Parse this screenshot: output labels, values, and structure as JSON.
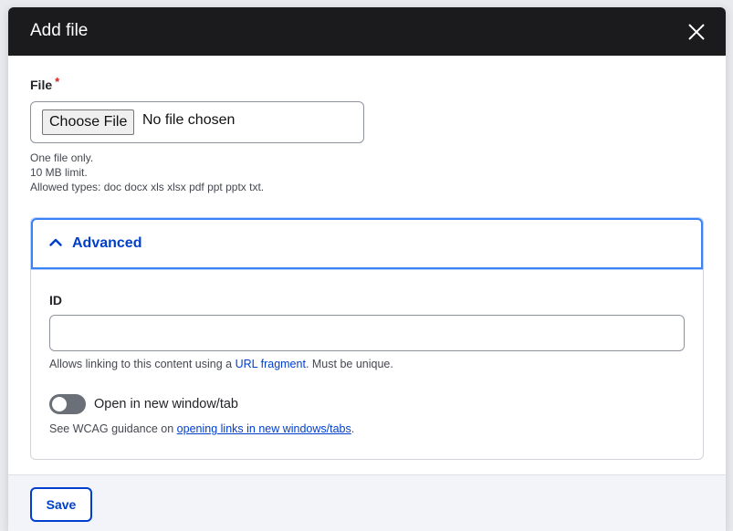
{
  "dialog": {
    "title": "Add file",
    "close_icon": "close-icon"
  },
  "file": {
    "label": "File",
    "required_marker": "*",
    "choose_button": "Choose File",
    "status": "No file chosen",
    "help": [
      "One file only.",
      "10 MB limit.",
      "Allowed types: doc docx xls xlsx pdf ppt pptx txt."
    ]
  },
  "advanced": {
    "title": "Advanced",
    "chevron_icon": "chevron-up-icon",
    "id": {
      "label": "ID",
      "value": "",
      "help_prefix": "Allows linking to this content using a ",
      "help_link": "URL fragment",
      "help_suffix": ". Must be unique."
    },
    "new_window": {
      "label": "Open in new window/tab",
      "enabled": false,
      "help_prefix": "See WCAG guidance on ",
      "help_link": "opening links in new windows/tabs",
      "help_suffix": "."
    }
  },
  "footer": {
    "save_label": "Save"
  },
  "colors": {
    "accent": "#003ecc",
    "titlebar": "#1b1b1d",
    "required": "#d72222",
    "focus": "#3b82f6"
  }
}
